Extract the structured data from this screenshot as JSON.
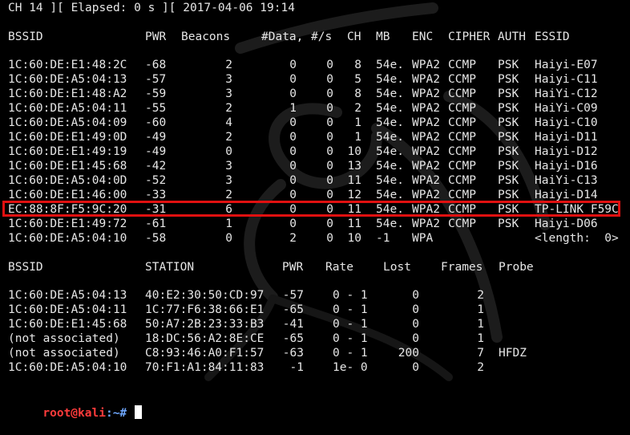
{
  "status_line": "CH 14 ][ Elapsed: 0 s ][ 2017-04-06 19:14",
  "ap_headers": {
    "bssid": "BSSID",
    "pwr": "PWR",
    "beacons": "Beacons",
    "data": "#Data,",
    "rate": "#/s",
    "ch": "CH",
    "mb": "MB",
    "enc": "ENC",
    "cipher": "CIPHER",
    "auth": "AUTH",
    "essid": "ESSID"
  },
  "access_points": [
    {
      "bssid": "1C:60:DE:E1:48:2C",
      "pwr": "-68",
      "beacons": "2",
      "data": "0",
      "rate": "0",
      "ch": "8",
      "mb": "54e.",
      "enc": "WPA2",
      "cipher": "CCMP",
      "auth": "PSK",
      "essid": "Haiyi-E07"
    },
    {
      "bssid": "1C:60:DE:A5:04:13",
      "pwr": "-57",
      "beacons": "3",
      "data": "0",
      "rate": "0",
      "ch": "5",
      "mb": "54e.",
      "enc": "WPA2",
      "cipher": "CCMP",
      "auth": "PSK",
      "essid": "Haiyi-C11"
    },
    {
      "bssid": "1C:60:DE:E1:48:A2",
      "pwr": "-59",
      "beacons": "3",
      "data": "0",
      "rate": "0",
      "ch": "8",
      "mb": "54e.",
      "enc": "WPA2",
      "cipher": "CCMP",
      "auth": "PSK",
      "essid": "HaiYi-C12"
    },
    {
      "bssid": "1C:60:DE:A5:04:11",
      "pwr": "-55",
      "beacons": "2",
      "data": "1",
      "rate": "0",
      "ch": "2",
      "mb": "54e.",
      "enc": "WPA2",
      "cipher": "CCMP",
      "auth": "PSK",
      "essid": "HaiYi-C09"
    },
    {
      "bssid": "1C:60:DE:A5:04:09",
      "pwr": "-60",
      "beacons": "4",
      "data": "0",
      "rate": "0",
      "ch": "1",
      "mb": "54e.",
      "enc": "WPA2",
      "cipher": "CCMP",
      "auth": "PSK",
      "essid": "Haiyi-C10"
    },
    {
      "bssid": "1C:60:DE:E1:49:0D",
      "pwr": "-49",
      "beacons": "2",
      "data": "0",
      "rate": "0",
      "ch": "1",
      "mb": "54e.",
      "enc": "WPA2",
      "cipher": "CCMP",
      "auth": "PSK",
      "essid": "Haiyi-D11"
    },
    {
      "bssid": "1C:60:DE:E1:49:19",
      "pwr": "-49",
      "beacons": "0",
      "data": "0",
      "rate": "0",
      "ch": "10",
      "mb": "54e.",
      "enc": "WPA2",
      "cipher": "CCMP",
      "auth": "PSK",
      "essid": "Haiyi-D12"
    },
    {
      "bssid": "1C:60:DE:E1:45:68",
      "pwr": "-42",
      "beacons": "3",
      "data": "0",
      "rate": "0",
      "ch": "13",
      "mb": "54e.",
      "enc": "WPA2",
      "cipher": "CCMP",
      "auth": "PSK",
      "essid": "Haiyi-D16"
    },
    {
      "bssid": "1C:60:DE:A5:04:0D",
      "pwr": "-52",
      "beacons": "3",
      "data": "0",
      "rate": "0",
      "ch": "11",
      "mb": "54e.",
      "enc": "WPA2",
      "cipher": "CCMP",
      "auth": "PSK",
      "essid": "HaiYi-C13"
    },
    {
      "bssid": "1C:60:DE:E1:46:00",
      "pwr": "-33",
      "beacons": "2",
      "data": "0",
      "rate": "0",
      "ch": "12",
      "mb": "54e.",
      "enc": "WPA2",
      "cipher": "CCMP",
      "auth": "PSK",
      "essid": "Haiyi-D14"
    },
    {
      "bssid": "EC:88:8F:F5:9C:20",
      "pwr": "-31",
      "beacons": "6",
      "data": "0",
      "rate": "0",
      "ch": "11",
      "mb": "54e.",
      "enc": "WPA2",
      "cipher": "CCMP",
      "auth": "PSK",
      "essid": "TP-LINK F59C",
      "highlighted": true
    },
    {
      "bssid": "1C:60:DE:E1:49:72",
      "pwr": "-61",
      "beacons": "1",
      "data": "0",
      "rate": "0",
      "ch": "11",
      "mb": "54e.",
      "enc": "WPA2",
      "cipher": "CCMP",
      "auth": "PSK",
      "essid": "Haiyi-D06"
    },
    {
      "bssid": "1C:60:DE:A5:04:10",
      "pwr": "-58",
      "beacons": "0",
      "data": "2",
      "rate": "0",
      "ch": "10",
      "mb": "-1",
      "enc": "WPA",
      "cipher": "",
      "auth": "",
      "essid": "<length:  0>"
    }
  ],
  "station_headers": {
    "bssid": "BSSID",
    "station": "STATION",
    "pwr": "PWR",
    "rate": "Rate",
    "lost": "Lost",
    "frames": "Frames",
    "probe": "Probe"
  },
  "stations": [
    {
      "bssid": "1C:60:DE:A5:04:13",
      "station": "40:E2:30:50:CD:97",
      "pwr": "-57",
      "rate": "0 - 1",
      "lost": "0",
      "frames": "2",
      "probe": ""
    },
    {
      "bssid": "1C:60:DE:A5:04:11",
      "station": "1C:77:F6:38:66:E1",
      "pwr": "-65",
      "rate": "0 - 1",
      "lost": "0",
      "frames": "1",
      "probe": ""
    },
    {
      "bssid": "1C:60:DE:E1:45:68",
      "station": "50:A7:2B:23:33:B3",
      "pwr": "-41",
      "rate": "0 - 1",
      "lost": "0",
      "frames": "1",
      "probe": ""
    },
    {
      "bssid": "(not associated)",
      "station": "18:DC:56:A2:8E:CE",
      "pwr": "-65",
      "rate": "0 - 1",
      "lost": "0",
      "frames": "1",
      "probe": ""
    },
    {
      "bssid": "(not associated)",
      "station": "C8:93:46:A0:F1:57",
      "pwr": "-63",
      "rate": "0 - 1",
      "lost": "200",
      "frames": "7",
      "probe": "HFDZ"
    },
    {
      "bssid": "1C:60:DE:A5:04:10",
      "station": "70:F1:A1:84:11:83",
      "pwr": "-1",
      "rate": "1e- 0",
      "lost": "0",
      "frames": "2",
      "probe": ""
    }
  ],
  "prompt": {
    "user": "root@kali",
    "path": ":~#"
  },
  "colors": {
    "background": "#000000",
    "text": "#e6e6e6",
    "highlight_border": "#e01010",
    "prompt_user": "#ff3b3b",
    "prompt_path": "#6fa8ff"
  },
  "icons": [
    "kali-dragon-watermark-icon",
    "cursor-block-icon"
  ]
}
